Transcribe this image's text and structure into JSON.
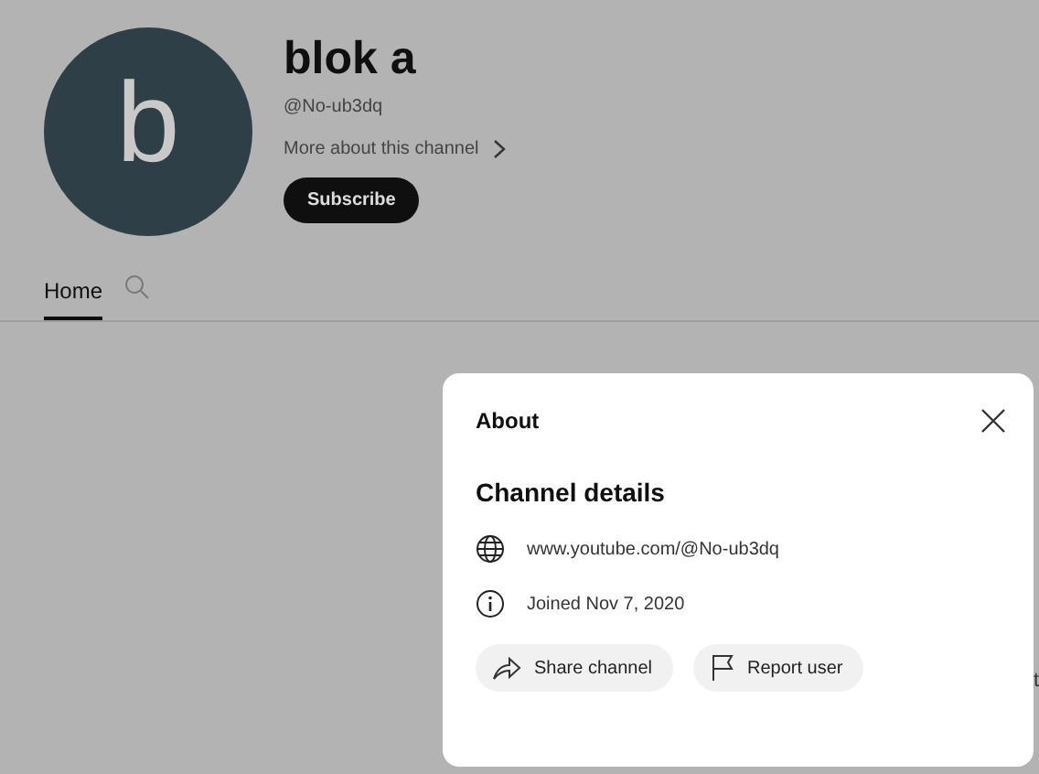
{
  "channel": {
    "avatar_letter": "b",
    "name": "blok a",
    "handle": "@No-ub3dq",
    "more_link": "More about this channel",
    "subscribe": "Subscribe"
  },
  "tabs": [
    {
      "label": "Home",
      "kind": "text",
      "selected": true
    },
    {
      "kind": "search",
      "selected": false
    }
  ],
  "peek_text": "t",
  "dialog": {
    "title": "About",
    "section": "Channel details",
    "details": [
      {
        "kind": "link",
        "text": "www.youtube.com/@No-ub3dq"
      },
      {
        "kind": "info",
        "text": "Joined Nov 7, 2020"
      }
    ],
    "buttons": [
      {
        "kind": "share",
        "label": "Share channel"
      },
      {
        "kind": "report",
        "label": "Report user"
      }
    ]
  }
}
